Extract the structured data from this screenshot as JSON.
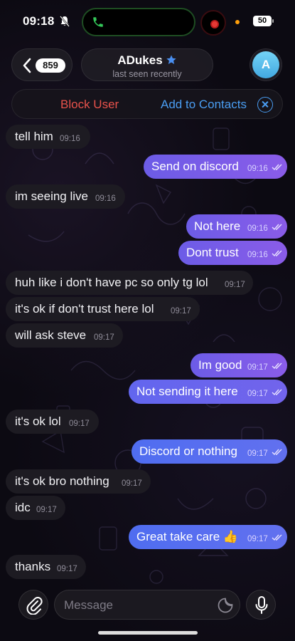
{
  "status_bar": {
    "time": "09:18",
    "battery": "50"
  },
  "header": {
    "back_count": "859",
    "chat_name": "ADukes",
    "last_seen": "last seen recently",
    "avatar_letter": "A"
  },
  "action_bar": {
    "block_label": "Block User",
    "add_label": "Add to Contacts"
  },
  "messages": [
    {
      "dir": "in",
      "text": "tell him",
      "time": "09:16"
    },
    {
      "dir": "out",
      "text": "Send on discord",
      "time": "09:16"
    },
    {
      "dir": "in",
      "text": "im seeing live",
      "time": "09:16"
    },
    {
      "dir": "out",
      "text": "Not here",
      "time": "09:16"
    },
    {
      "dir": "out",
      "text": "Dont trust",
      "time": "09:16"
    },
    {
      "dir": "in",
      "text": "huh like i don't have pc so only tg lol",
      "time": "09:17"
    },
    {
      "dir": "in",
      "text": "it's ok if don't trust here lol",
      "time": "09:17"
    },
    {
      "dir": "in",
      "text": "will ask steve",
      "time": "09:17"
    },
    {
      "dir": "out",
      "text": "Im good",
      "time": "09:17"
    },
    {
      "dir": "out",
      "text": "Not sending it here",
      "time": "09:17"
    },
    {
      "dir": "in",
      "text": "it's ok lol",
      "time": "09:17"
    },
    {
      "dir": "out",
      "text": "Discord or nothing",
      "time": "09:17"
    },
    {
      "dir": "in",
      "text": "it's ok bro nothing",
      "time": "09:17"
    },
    {
      "dir": "in",
      "text": "idc",
      "time": "09:17"
    },
    {
      "dir": "out",
      "text": "Great take care 👍",
      "time": "09:17"
    },
    {
      "dir": "in",
      "text": "thanks",
      "time": "09:17"
    }
  ],
  "input": {
    "placeholder": "Message"
  },
  "icons": {
    "mute": "bell-slash-icon",
    "call": "phone-icon",
    "verified": "star-icon",
    "attach": "paperclip-icon",
    "sticker": "sticker-icon",
    "mic": "microphone-icon",
    "read": "double-check-icon"
  },
  "colors": {
    "outgoing_bubble": "#7b5de8",
    "outgoing_bubble_blue": "#5a6ff0",
    "incoming_bubble": "#1d1b22",
    "block_red": "#e8524b",
    "link_blue": "#4a9df2",
    "avatar": "#5bbbeb"
  }
}
